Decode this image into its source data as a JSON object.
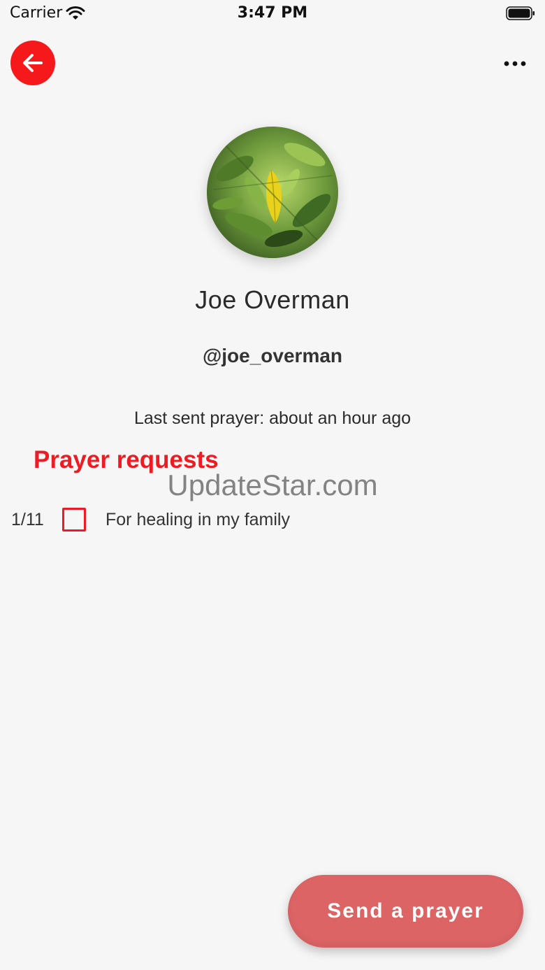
{
  "status_bar": {
    "carrier": "Carrier",
    "time": "3:47 PM"
  },
  "nav": {
    "back_icon": "arrow-left-icon",
    "more_icon": "more-horizontal-icon",
    "accent_color": "#f5191b"
  },
  "profile": {
    "name": "Joe Overman",
    "handle": "@joe_overman",
    "last_sent": "Last sent prayer: about an hour ago"
  },
  "prayer_requests": {
    "title": "Prayer requests",
    "items": [
      {
        "count": "1/11",
        "text": "For healing in my family",
        "checked": false
      }
    ]
  },
  "watermark": "UpdateStar.com",
  "actions": {
    "send_label": "Send a prayer",
    "send_color": "#dc6465"
  }
}
